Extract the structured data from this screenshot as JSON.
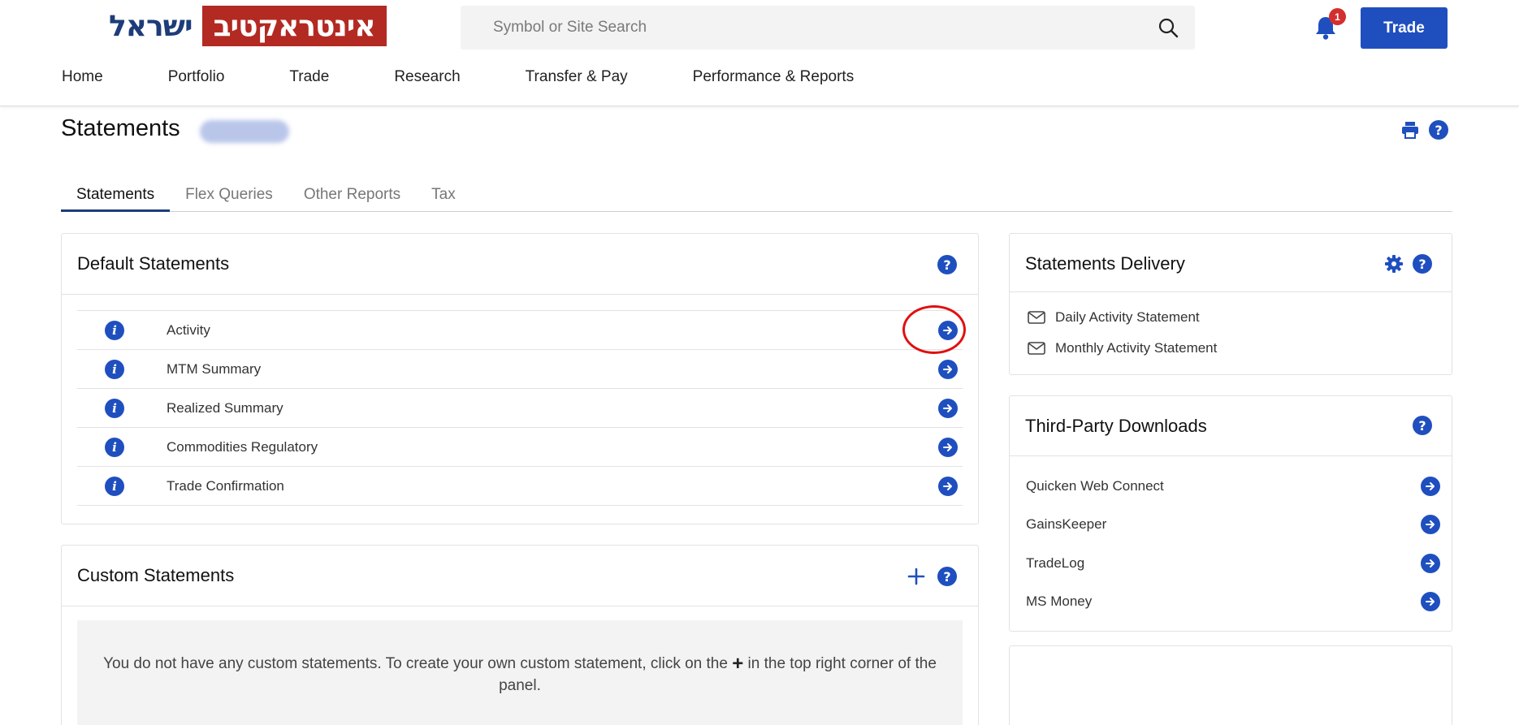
{
  "header": {
    "logo_text": "ישראל",
    "logo_box_text": "אינטראקטיב",
    "search_placeholder": "Symbol or Site Search",
    "notification_count": "1",
    "trade_button": "Trade"
  },
  "nav": {
    "items": [
      "Home",
      "Portfolio",
      "Trade",
      "Research",
      "Transfer & Pay",
      "Performance & Reports"
    ]
  },
  "page": {
    "title": "Statements"
  },
  "tabs": [
    "Statements",
    "Flex Queries",
    "Other Reports",
    "Tax"
  ],
  "default_statements": {
    "title": "Default Statements",
    "rows": [
      "Activity",
      "MTM Summary",
      "Realized Summary",
      "Commodities Regulatory",
      "Trade Confirmation"
    ]
  },
  "custom_statements": {
    "title": "Custom Statements",
    "empty_text_before": "You do not have any custom statements. To create your own custom statement, click on the",
    "empty_plus": "+",
    "empty_text_after": "in the top right corner of the panel."
  },
  "statements_delivery": {
    "title": "Statements Delivery",
    "items": [
      "Daily Activity Statement",
      "Monthly Activity Statement"
    ]
  },
  "third_party": {
    "title": "Third-Party Downloads",
    "items": [
      "Quicken Web Connect",
      "GainsKeeper",
      "TradeLog",
      "MS Money"
    ]
  },
  "icons": {
    "help": "?",
    "info": "i"
  },
  "colors": {
    "brand_blue": "#1f4fbf",
    "logo_red": "#b32a22",
    "logo_navy": "#1d3c79",
    "highlight_red": "#e01010"
  }
}
